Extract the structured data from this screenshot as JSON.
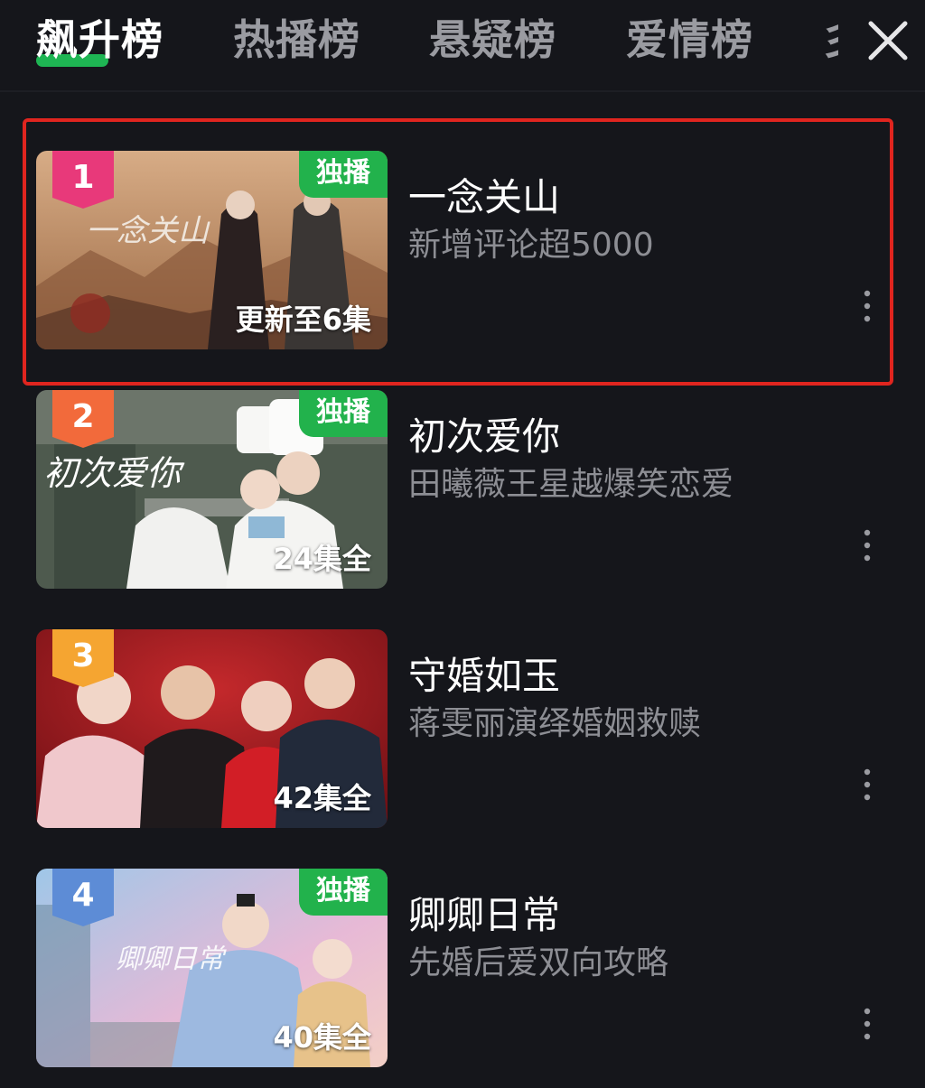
{
  "tabs": [
    {
      "label": "飙升榜",
      "active": true
    },
    {
      "label": "热播榜",
      "active": false
    },
    {
      "label": "悬疑榜",
      "active": false
    },
    {
      "label": "爱情榜",
      "active": false
    }
  ],
  "tab_partial": "彡",
  "colors": {
    "background": "#15161b",
    "accent": "#1fc65a",
    "exclusive_badge": "#22b24c",
    "highlight_border": "#e0251f",
    "rank1": "#e8397a",
    "rank2": "#f26a3b",
    "rank3": "#f5a531",
    "rank4": "#5d8cd6"
  },
  "items": [
    {
      "rank": "1",
      "title": "一念关山",
      "subtitle": "新增评论超5000",
      "exclusive": "独播",
      "episodes": "更新至6集",
      "highlighted": true
    },
    {
      "rank": "2",
      "title": "初次爱你",
      "subtitle": "田曦薇王星越爆笑恋爱",
      "exclusive": "独播",
      "episodes": "24集全",
      "highlighted": false
    },
    {
      "rank": "3",
      "title": "守婚如玉",
      "subtitle": "蒋雯丽演绎婚姻救赎",
      "exclusive": "",
      "episodes": "42集全",
      "highlighted": false
    },
    {
      "rank": "4",
      "title": "卿卿日常",
      "subtitle": "先婚后爱双向攻略",
      "exclusive": "独播",
      "episodes": "40集全",
      "highlighted": false
    }
  ],
  "icons": {
    "close": "close-icon",
    "more": "more-vertical-icon"
  }
}
